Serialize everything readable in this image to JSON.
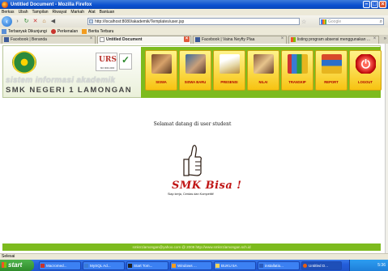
{
  "window": {
    "title": "Untitled Document - Mozilla Firefox",
    "controls": [
      "minimize",
      "maximize",
      "close"
    ]
  },
  "menubar": [
    "Berkas",
    "Ubah",
    "Tampilan",
    "Riwayat",
    "Markah",
    "Alat",
    "Bantuan"
  ],
  "navigation": {
    "url": "http://localhost:8080/akademik/Templates/user.jsp",
    "search_placeholder": "Google"
  },
  "bookmarks": [
    "Terbanyak Dikunjungi",
    "Perkenalan",
    "Berita Terbaru"
  ],
  "tabs": [
    {
      "label": "Facebook | Beranda",
      "active": false
    },
    {
      "label": "Untitled Document",
      "active": true
    },
    {
      "label": "Facebook | Vaina Neyfty Plaa",
      "active": false
    },
    {
      "label": "listing program absensi menggunakan ...",
      "active": false
    }
  ],
  "page": {
    "school_tagline": "sistem informasi akademik",
    "school_name": "SMK NEGERI 1 LAMONGAN",
    "urs_logo_text": "URS",
    "iso_text": "ISO 9001:2000",
    "menu": [
      "SISWA",
      "SISWA BARU",
      "PRESENSI",
      "NILAI",
      "TRANSKIP",
      "REPORT",
      "LOGOUT"
    ],
    "welcome": "Selamat datang di user student",
    "motto_title": "SMK Bisa !",
    "motto_tagline": "Siap kerja, Cerdas dan Kompetitif",
    "footer": "smkn1lamongan@yahoo.com @ 2009 http://www.smkn1lamongan.sch.id"
  },
  "status": "Selesai",
  "taskbar": {
    "start": "start",
    "tasks": [
      "Macromed...",
      "MySQL Ad...",
      "Start Tom...",
      "Windows ...",
      "BUKU 5A",
      "installatio...",
      "Untitled D..."
    ],
    "clock": "5:36"
  },
  "colors": {
    "titlebar": "#0a4fcf",
    "menu_nav_green": "#7dbb1e",
    "menu_button_yellow": "#f7c311",
    "menu_label_red": "#b00000",
    "motto_red": "#c01414",
    "taskbar_blue": "#245edb",
    "start_green": "#2f8b2b"
  }
}
